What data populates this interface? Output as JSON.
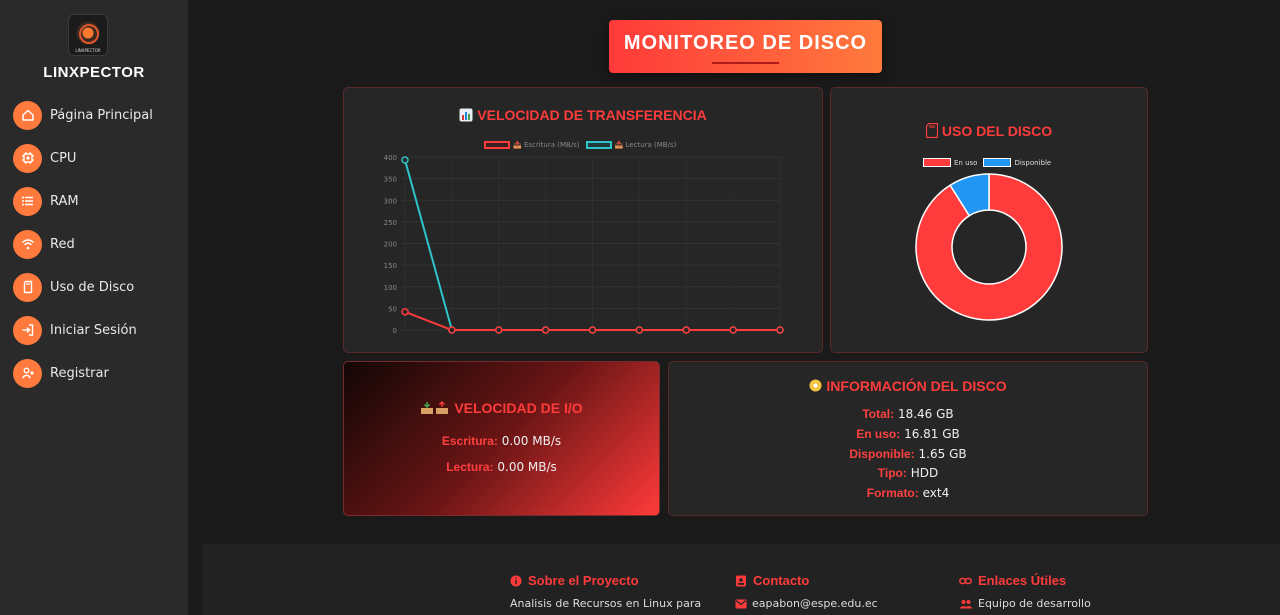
{
  "sidebar": {
    "logo_caption": "LINXPECTOR",
    "brand": "LINXPECTOR",
    "items": [
      {
        "label": "Página Principal",
        "icon": "home-icon"
      },
      {
        "label": "CPU",
        "icon": "cpu-icon"
      },
      {
        "label": "RAM",
        "icon": "list-icon"
      },
      {
        "label": "Red",
        "icon": "wifi-icon"
      },
      {
        "label": "Uso de Disco",
        "icon": "sd-card-icon"
      },
      {
        "label": "Iniciar Sesión",
        "icon": "login-icon"
      },
      {
        "label": "Registrar",
        "icon": "user-add-icon"
      }
    ]
  },
  "header": {
    "title": "MONITOREO DE DISCO"
  },
  "transfer_card": {
    "title": "VELOCIDAD DE TRANSFERENCIA",
    "legend_write": "📤 Escritura (MB/s)",
    "legend_read": "📥 Lectura (MB/s)"
  },
  "usage_card": {
    "title": "USO DEL DISCO",
    "legend_used": "En uso",
    "legend_free": "Disponible"
  },
  "io_card": {
    "title": "VELOCIDAD DE I/O",
    "write_label": "Escritura:",
    "write_value": "0.00 MB/s",
    "read_label": "Lectura:",
    "read_value": "0.00 MB/s"
  },
  "info_card": {
    "title": "INFORMACIÓN DEL DISCO",
    "rows": [
      {
        "label": "Total:",
        "value": "18.46 GB"
      },
      {
        "label": "En uso:",
        "value": "16.81 GB"
      },
      {
        "label": "Disponible:",
        "value": "1.65 GB"
      },
      {
        "label": "Tipo:",
        "value": "HDD"
      },
      {
        "label": "Formato:",
        "value": "ext4"
      }
    ]
  },
  "footer": {
    "about_title": "Sobre el Proyecto",
    "about_text": "Analisis de Recursos en Linux para",
    "contact_title": "Contacto",
    "contact_email": "eapabon@espe.edu.ec",
    "links_title": "Enlaces Útiles",
    "links_item": "Equipo de desarrollo"
  },
  "colors": {
    "accent": "#ff3b3b",
    "orange": "#ff7a3c",
    "write": "#ff3b3b",
    "read": "#2ec4c9",
    "free": "#2196f3"
  },
  "chart_data": [
    {
      "type": "line",
      "x": [
        "",
        "",
        "",
        "",
        "",
        "",
        "",
        "",
        ""
      ],
      "series": [
        {
          "name": "📤 Escritura (MB/s)",
          "values": [
            42,
            0,
            0,
            0,
            0,
            0,
            0,
            0,
            0
          ]
        },
        {
          "name": "📥 Lectura (MB/s)",
          "values": [
            393,
            0,
            0,
            0,
            0,
            0,
            0,
            0,
            0
          ]
        }
      ],
      "yticks": [
        400,
        350,
        300,
        250,
        200,
        150,
        100,
        50,
        0
      ],
      "ylim": [
        0,
        400
      ],
      "grid": true,
      "legend": "top"
    },
    {
      "type": "pie",
      "labels": [
        "En uso",
        "Disponible"
      ],
      "values": [
        16.81,
        1.65
      ],
      "colors": [
        "#ff3b3b",
        "#2196f3"
      ],
      "legend": "top"
    }
  ]
}
